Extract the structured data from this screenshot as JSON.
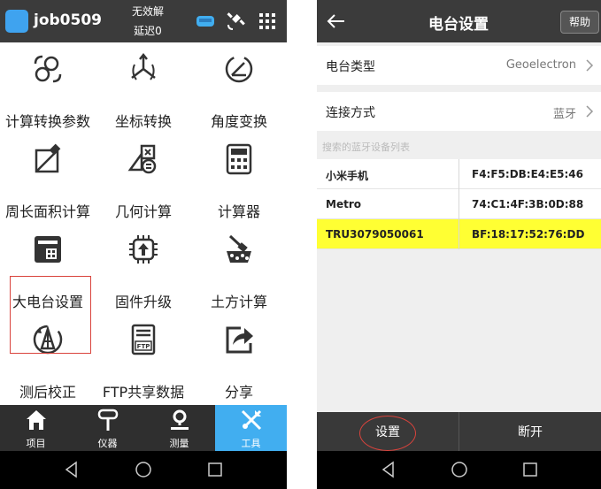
{
  "left": {
    "header": {
      "job": "job0509",
      "status_line1": "无效解",
      "status_line2": "延迟0"
    },
    "grid": [
      {
        "label": "计算转换参数",
        "icon": "globe-sync-icon"
      },
      {
        "label": "坐标转换",
        "icon": "axes-icon"
      },
      {
        "label": "角度变换",
        "icon": "angle-icon"
      },
      {
        "label": "周长面积计算",
        "icon": "area-icon"
      },
      {
        "label": "几何计算",
        "icon": "geometry-calc-icon"
      },
      {
        "label": "计算器",
        "icon": "calculator-icon"
      },
      {
        "label": "大电台设置",
        "icon": "radio-icon"
      },
      {
        "label": "固件升级",
        "icon": "chip-upgrade-icon"
      },
      {
        "label": "土方计算",
        "icon": "earthwork-icon"
      },
      {
        "label": "测后校正",
        "icon": "correction-icon"
      },
      {
        "label": "FTP共享数据",
        "icon": "ftp-icon"
      },
      {
        "label": "分享",
        "icon": "share-icon"
      }
    ],
    "tabs": [
      {
        "label": "项目",
        "icon": "home-icon"
      },
      {
        "label": "仪器",
        "icon": "instrument-icon"
      },
      {
        "label": "测量",
        "icon": "location-icon"
      },
      {
        "label": "工具",
        "icon": "tools-icon",
        "active": true
      }
    ]
  },
  "right": {
    "header": {
      "title": "电台设置",
      "help": "帮助"
    },
    "rows": [
      {
        "key": "电台类型",
        "value": "Geoelectron"
      },
      {
        "key": "连接方式",
        "value": "蓝牙"
      }
    ],
    "section_label": "搜索的蓝牙设备列表",
    "devices": [
      {
        "name": "小米手机",
        "address": "F4:F5:DB:E4:E5:46"
      },
      {
        "name": "Metro",
        "address": "74:C1:4F:3B:0D:88"
      },
      {
        "name": "TRU3079050061",
        "address": "BF:18:17:52:76:DD",
        "selected": true
      }
    ],
    "footer": {
      "setup": "设置",
      "disconnect": "断开"
    }
  },
  "colors": {
    "accent": "#41aef0",
    "highlight": "#ffff33",
    "annotation": "#d9433c",
    "header_bg": "#3b3b3b"
  }
}
